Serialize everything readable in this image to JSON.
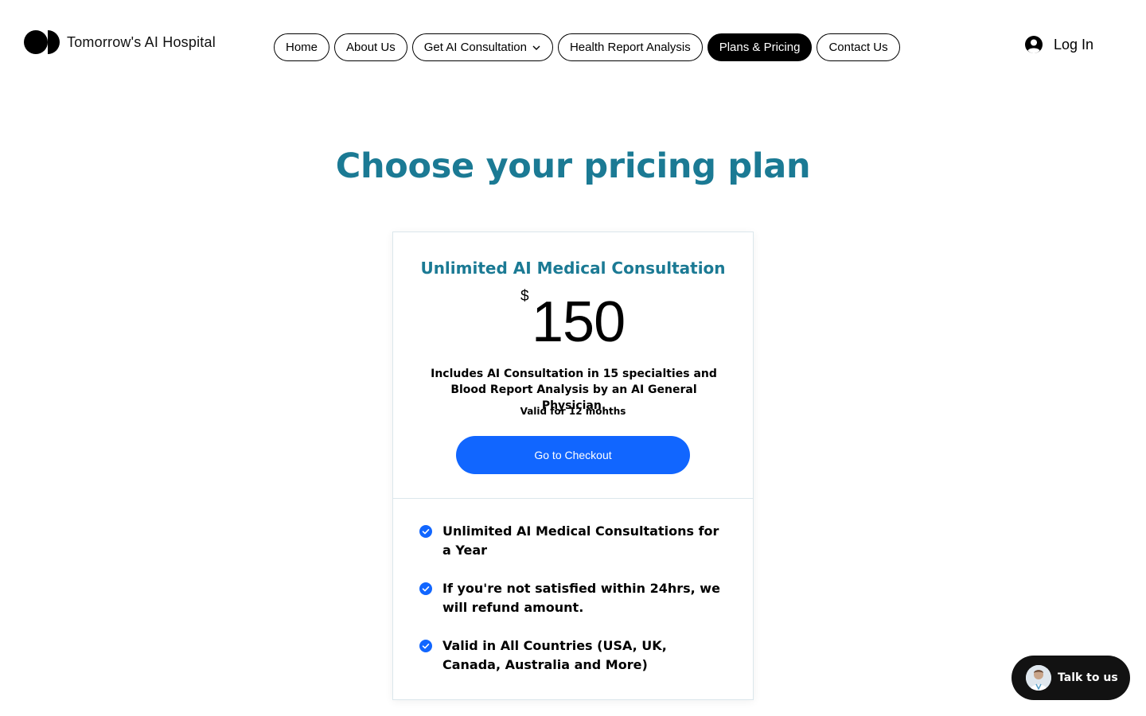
{
  "header": {
    "logo_text": "Tomorrow's AI Hospital",
    "login_label": "Log In"
  },
  "nav": {
    "home": "Home",
    "about": "About Us",
    "consultation": "Get AI Consultation",
    "health_report": "Health Report Analysis",
    "pricing": "Plans & Pricing",
    "contact": "Contact Us",
    "active": "Plans & Pricing"
  },
  "main": {
    "title": "Choose your pricing plan"
  },
  "plan": {
    "name": "Unlimited AI Medical Consultation",
    "currency": "$",
    "price": "150",
    "description": "Includes AI Consultation in 15 specialties and Blood Report Analysis by an AI General Physician.",
    "validity": "Valid for 12 months",
    "checkout_label": "Go to Checkout",
    "features": [
      "Unlimited AI Medical Consultations for a Year",
      "If you're not satisfied within 24hrs, we will refund amount.",
      "Valid in All Countries (USA, UK, Canada, Australia and More)"
    ]
  },
  "chat": {
    "label": "Talk to us"
  },
  "colors": {
    "title": "#1b7a94",
    "accent": "#1166ff",
    "nav_active_bg": "#000000",
    "chat_bg": "#121212"
  },
  "icons": {
    "logo": "logo-mark-icon",
    "dropdown": "chevron-down-icon",
    "login": "user-circle-icon",
    "feature": "check-circle-icon",
    "chat_avatar": "agent-avatar-icon"
  }
}
